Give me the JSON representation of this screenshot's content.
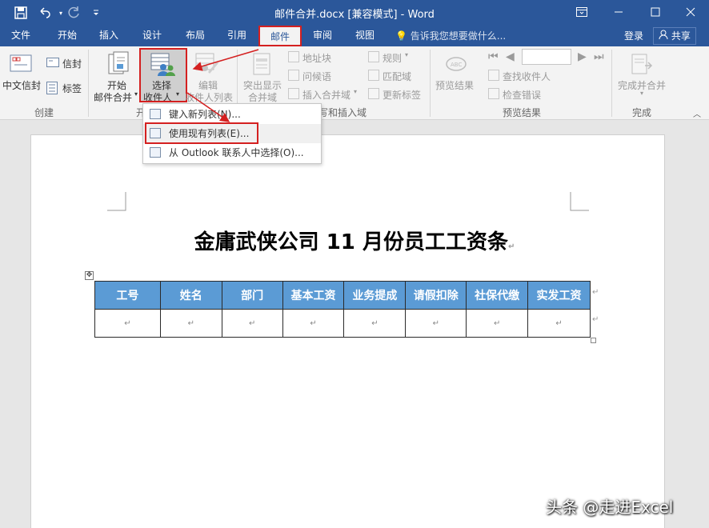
{
  "window": {
    "title": "邮件合并.docx [兼容模式] - Word"
  },
  "tabs": [
    "文件",
    "开始",
    "插入",
    "设计",
    "布局",
    "引用",
    "邮件",
    "审阅",
    "视图"
  ],
  "tell_me": "告诉我您想要做什么...",
  "login": "登录",
  "share": "共享",
  "ribbon": {
    "create": {
      "label": "创建",
      "chinese_envelope": "中文信封",
      "envelopes": "信封",
      "labels": "标签"
    },
    "start_merge": {
      "label_partial": "开",
      "start_line1": "开始",
      "start_line2": "邮件合并",
      "select_line1": "选择",
      "select_line2": "收件人",
      "edit_line1": "编辑",
      "edit_line2": "收件人列表"
    },
    "write_insert": {
      "label_partial": "写和插入域",
      "highlight_line1": "突出显示",
      "highlight_line2": "合并域",
      "address_block": "地址块",
      "greeting_line": "问候语",
      "insert_merge_field": "插入合并域",
      "rules": "规则",
      "match_fields": "匹配域",
      "update_labels": "更新标签"
    },
    "preview": {
      "label": "预览结果",
      "preview_results": "预览结果",
      "find_recipient": "查找收件人",
      "check_errors": "检查错误"
    },
    "finish": {
      "label": "完成",
      "finish_merge": "完成并合并"
    }
  },
  "menu": {
    "items": [
      {
        "label": "键入新列表(N)..."
      },
      {
        "label": "使用现有列表(E)..."
      },
      {
        "label": "从 Outlook 联系人中选择(O)..."
      }
    ]
  },
  "document": {
    "title": "金庸武侠公司 11 月份员工工资条",
    "table": {
      "headers": [
        "工号",
        "姓名",
        "部门",
        "基本工资",
        "业务提成",
        "请假扣除",
        "社保代缴",
        "实发工资"
      ],
      "row_marks": [
        "↵",
        "↵",
        "↵",
        "↵",
        "↵",
        "↵",
        "↵",
        "↵"
      ]
    },
    "paragraph_mark": "↵"
  },
  "watermark": "头条 @走进Excel",
  "colors": {
    "word_blue": "#2b579a",
    "header_fill": "#5b9bd5",
    "highlight_red": "#d42020"
  }
}
